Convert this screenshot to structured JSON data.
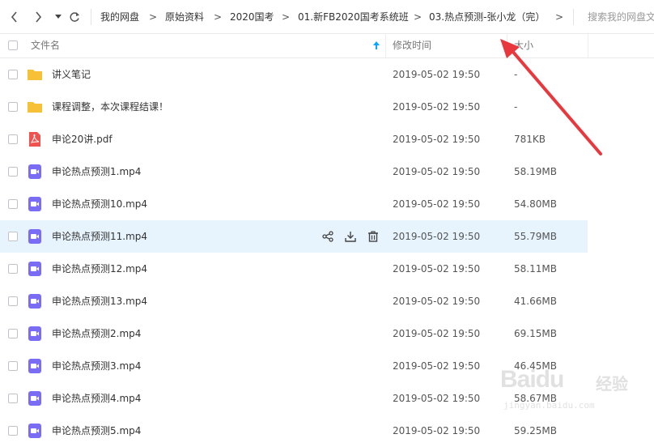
{
  "nav": {
    "back_icon": "chevron-left-icon",
    "forward_icon": "chevron-right-icon",
    "history_icon": "caret-down-icon",
    "refresh_icon": "refresh-icon"
  },
  "breadcrumb": [
    "我的网盘",
    "原始资料",
    "2020国考",
    "01.新FB2020国考系统班",
    "03.热点预测-张小龙（完）"
  ],
  "breadcrumb_separator": ">",
  "search": {
    "placeholder": "搜索我的网盘文件"
  },
  "header": {
    "name": "文件名",
    "modified": "修改时间",
    "size": "大小",
    "sort_icon": "sort-up-arrow-icon"
  },
  "rows": [
    {
      "name": "讲义笔记",
      "date": "2019-05-02 19:50",
      "size": "-",
      "type": "folder"
    },
    {
      "name": "课程调整，本次课程结课！",
      "date": "2019-05-02 19:50",
      "size": "-",
      "type": "folder"
    },
    {
      "name": "申论20讲.pdf",
      "date": "2019-05-02 19:50",
      "size": "781KB",
      "type": "pdf"
    },
    {
      "name": "申论热点预测1.mp4",
      "date": "2019-05-02 19:50",
      "size": "58.19MB",
      "type": "video"
    },
    {
      "name": "申论热点预测10.mp4",
      "date": "2019-05-02 19:50",
      "size": "54.80MB",
      "type": "video"
    },
    {
      "name": "申论热点预测11.mp4",
      "date": "2019-05-02 19:50",
      "size": "55.79MB",
      "type": "video"
    },
    {
      "name": "申论热点预测12.mp4",
      "date": "2019-05-02 19:50",
      "size": "58.11MB",
      "type": "video"
    },
    {
      "name": "申论热点预测13.mp4",
      "date": "2019-05-02 19:50",
      "size": "41.66MB",
      "type": "video"
    },
    {
      "name": "申论热点预测2.mp4",
      "date": "2019-05-02 19:50",
      "size": "69.15MB",
      "type": "video"
    },
    {
      "name": "申论热点预测3.mp4",
      "date": "2019-05-02 19:50",
      "size": "46.45MB",
      "type": "video"
    },
    {
      "name": "申论热点预测4.mp4",
      "date": "2019-05-02 19:50",
      "size": "58.67MB",
      "type": "video"
    },
    {
      "name": "申论热点预测5.mp4",
      "date": "2019-05-02 19:50",
      "size": "59.25MB",
      "type": "video"
    }
  ],
  "row_actions": [
    "share-icon",
    "download-icon",
    "delete-icon"
  ],
  "watermark": {
    "brand": "Baidu",
    "suffix": "经验",
    "url": "jingyan.baidu.com"
  },
  "colors": {
    "folder": "#f7c137",
    "pdf": "#ef5350",
    "video": "#7b6cf6",
    "row_hover": "#e8f4fd",
    "annotation_arrow": "#e8383d",
    "sort_arrow": "#06a7ff"
  }
}
